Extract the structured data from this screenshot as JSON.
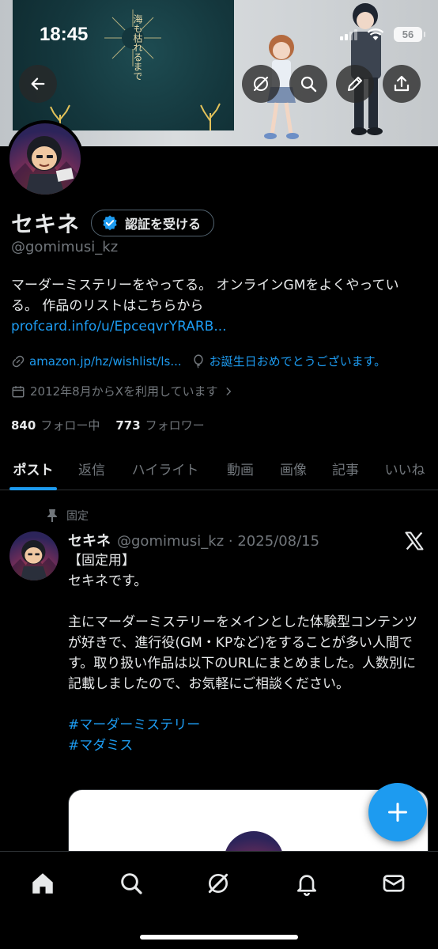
{
  "status_bar": {
    "time": "18:45",
    "battery": "56"
  },
  "banner": {
    "poster_title": "海も枯れるまで"
  },
  "header_buttons": {
    "back_icon": "arrow-left-icon",
    "grok_icon": "grok-icon",
    "search_icon": "search-icon",
    "edit_icon": "pencil-icon",
    "share_icon": "share-icon"
  },
  "profile": {
    "display_name": "セキネ",
    "verify_label": "認証を受ける",
    "handle": "@gomimusi_kz",
    "bio_text": "マーダーミステリーをやってる。 オンラインGMをよくやっている。 作品のリストはこちらから ",
    "bio_link": "profcard.info/u/EpceqvrYRARB...",
    "website": "amazon.jp/hz/wishlist/ls...",
    "birthday_text": "お誕生日おめでとうございます。",
    "joined": "2012年8月からXを利用しています",
    "following_count": "840",
    "following_label": "フォロー中",
    "followers_count": "773",
    "followers_label": "フォロワー"
  },
  "tabs": [
    {
      "label": "ポスト",
      "active": true
    },
    {
      "label": "返信",
      "active": false
    },
    {
      "label": "ハイライト",
      "active": false
    },
    {
      "label": "動画",
      "active": false
    },
    {
      "label": "画像",
      "active": false
    },
    {
      "label": "記事",
      "active": false
    },
    {
      "label": "いいね",
      "active": false
    }
  ],
  "tweet": {
    "pinned_label": "固定",
    "name": "セキネ",
    "handle_date": "@gomimusi_kz · 2025/08/15",
    "line1": "【固定用】",
    "line2": "セキネです。",
    "paragraph": "主にマーダーミステリーをメインとした体験型コンテンツが好きで、進行役(GM・KPなど)をすることが多い人間です。取り扱い作品は以下のURLにまとめました。人数別に記載しましたので、お気軽にご相談ください。",
    "hashtag1": "#マーダーミステリー",
    "hashtag2": "#マダミス"
  },
  "bottom_nav": [
    "home-icon",
    "search-icon",
    "grok-icon",
    "bell-icon",
    "mail-icon"
  ],
  "colors": {
    "accent": "#1d9bf0",
    "muted": "#71767b",
    "text": "#e7e9ea",
    "background": "#000000"
  }
}
